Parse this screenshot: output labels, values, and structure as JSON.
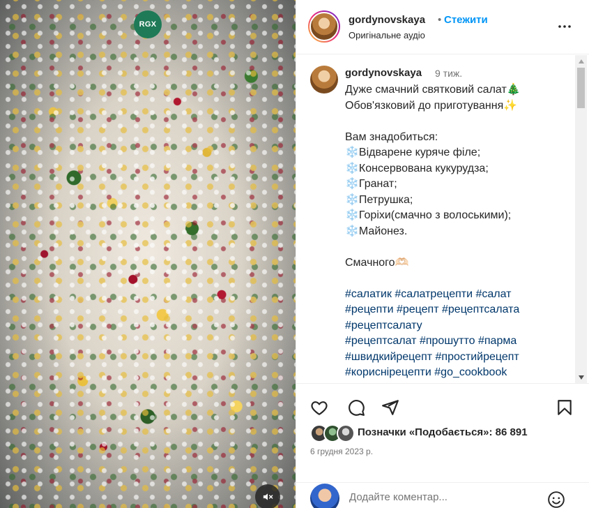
{
  "media": {
    "badge_text": "RGX"
  },
  "header": {
    "username": "gordynovskaya",
    "dot": "•",
    "follow_label": "Стежити",
    "audio_label": "Оригінальне аудіо"
  },
  "caption": {
    "username": "gordynovskaya",
    "time_ago": "9 тиж.",
    "lines": [
      "Дуже смачний святковий салат🎄",
      "Обов'язковий до приготування✨",
      "",
      "Вам знадобиться:",
      "❄️Відварене куряче філе;",
      "❄️Консервована кукурудза;",
      "❄️Гранат;",
      "❄️Петрушка;",
      "❄️Горіхи(смачно з волоськими);",
      "❄️Майонез.",
      "",
      "Смачного🫶🏻",
      ""
    ],
    "hashtag_lines": [
      [
        "#салатик",
        "#салатрецепти",
        "#салат"
      ],
      [
        "#рецепти",
        "#рецепт",
        "#рецептсалата"
      ],
      [
        "#рецептсалату"
      ],
      [
        "#рецептсалат",
        "#прошутто",
        "#парма"
      ],
      [
        "#швидкийрецепт",
        "#простийрецепт"
      ],
      [
        "#кориснірецепти",
        "#go_cookbook"
      ]
    ]
  },
  "actions": {
    "likes_text": "Позначки «Подобається»: 86 891",
    "date": "6 грудня 2023 р."
  },
  "comment": {
    "placeholder": "Додайте коментар..."
  },
  "icons": {
    "like": "heart-icon",
    "comment": "comment-icon",
    "share": "share-icon",
    "save": "bookmark-icon",
    "more": "more-icon",
    "mute": "muted-speaker-icon",
    "emoji": "emoji-icon"
  },
  "colors": {
    "accent": "#0095f6",
    "hashtag": "#00376b",
    "secondary_text": "#737373"
  }
}
